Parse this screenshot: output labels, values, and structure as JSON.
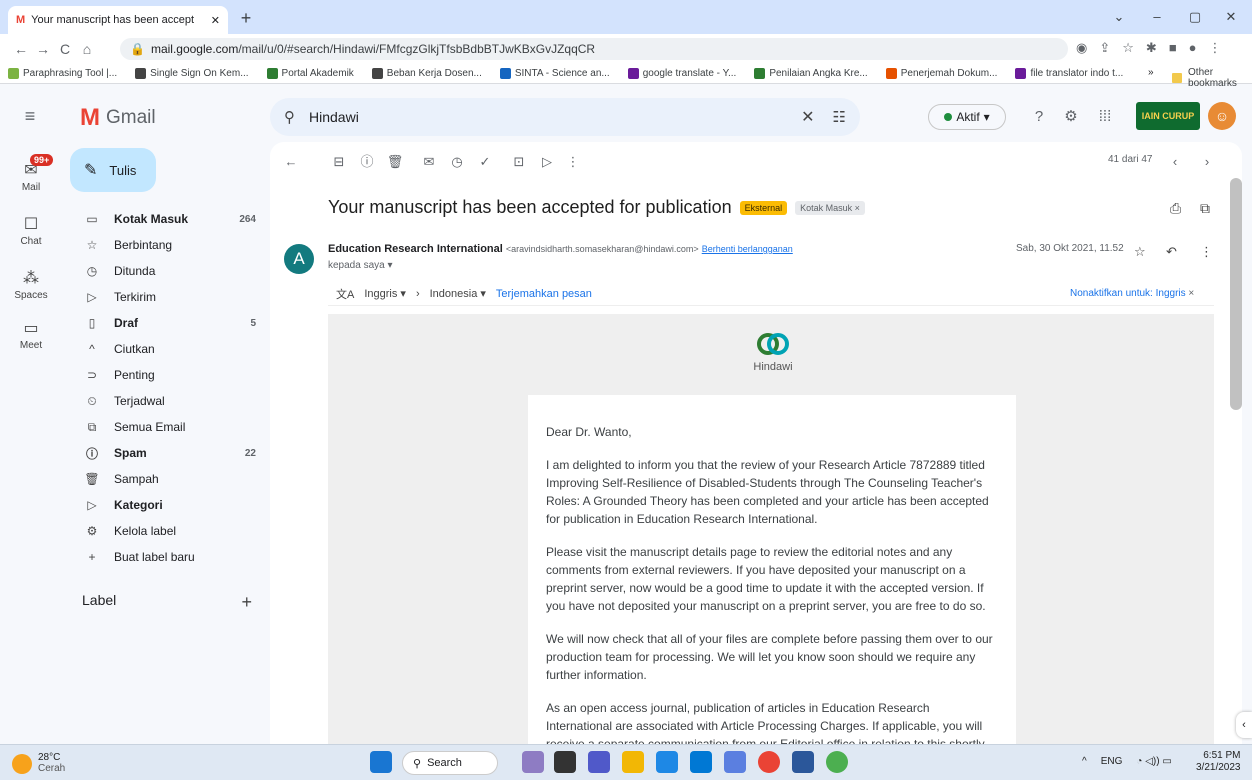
{
  "browser": {
    "tab_title": "Your manuscript has been accept",
    "url_host": "mail.google.com",
    "url_path": "/mail/u/0/#search/Hindawi/FMfcgzGlkjTfsbBdbBTJwKBxGvJZqqCR",
    "bookmarks": [
      {
        "label": "Paraphrasing Tool |...",
        "color": "#7cb342"
      },
      {
        "label": "Single Sign On Kem...",
        "color": "#444"
      },
      {
        "label": "Portal Akademik",
        "color": "#2e7d32"
      },
      {
        "label": "Beban Kerja Dosen...",
        "color": "#444"
      },
      {
        "label": "SINTA - Science an...",
        "color": "#1565c0"
      },
      {
        "label": "google translate - Y...",
        "color": "#6a1b9a"
      },
      {
        "label": "Penilaian Angka Kre...",
        "color": "#2e7d32"
      },
      {
        "label": "Penerjemah Dokum...",
        "color": "#e65100"
      },
      {
        "label": "file translator indo t...",
        "color": "#6a1b9a"
      }
    ],
    "more_bookmarks": "»",
    "other_bookmarks": "Other bookmarks"
  },
  "gmail": {
    "logo_text": "Gmail",
    "search_query": "Hindawi",
    "status_label": "Aktif",
    "org_logo_text": "IAIN CURUP",
    "avatar_initial": "☺"
  },
  "rail": {
    "badge": "99+",
    "items": [
      {
        "label": "Mail",
        "icon": "✉"
      },
      {
        "label": "Chat",
        "icon": "☐"
      },
      {
        "label": "Spaces",
        "icon": "⁂"
      },
      {
        "label": "Meet",
        "icon": "▭"
      }
    ]
  },
  "compose_label": "Tulis",
  "nav": [
    {
      "label": "Kotak Masuk",
      "count": "264",
      "icon": "▭",
      "bold": true,
      "name": "inbox"
    },
    {
      "label": "Berbintang",
      "count": "",
      "icon": "☆",
      "bold": false,
      "name": "starred"
    },
    {
      "label": "Ditunda",
      "count": "",
      "icon": "◷",
      "bold": false,
      "name": "snoozed"
    },
    {
      "label": "Terkirim",
      "count": "",
      "icon": "▷",
      "bold": false,
      "name": "sent"
    },
    {
      "label": "Draf",
      "count": "5",
      "icon": "▯",
      "bold": true,
      "name": "drafts"
    },
    {
      "label": "Ciutkan",
      "count": "",
      "icon": "^",
      "bold": false,
      "name": "collapse"
    },
    {
      "label": "Penting",
      "count": "",
      "icon": "⊃",
      "bold": false,
      "name": "important"
    },
    {
      "label": "Terjadwal",
      "count": "",
      "icon": "⏲",
      "bold": false,
      "name": "scheduled"
    },
    {
      "label": "Semua Email",
      "count": "",
      "icon": "⧉",
      "bold": false,
      "name": "all-mail"
    },
    {
      "label": "Spam",
      "count": "22",
      "icon": "ⓘ",
      "bold": true,
      "name": "spam"
    },
    {
      "label": "Sampah",
      "count": "",
      "icon": "🗑",
      "bold": false,
      "name": "trash"
    },
    {
      "label": "Kategori",
      "count": "",
      "icon": "▷",
      "bold": true,
      "name": "categories"
    },
    {
      "label": "Kelola label",
      "count": "",
      "icon": "⚙",
      "bold": false,
      "name": "manage-labels"
    },
    {
      "label": "Buat label baru",
      "count": "",
      "icon": "+",
      "bold": false,
      "name": "new-label"
    }
  ],
  "label_header": "Label",
  "label_add": "+",
  "pager": "41 dari 47",
  "email": {
    "subject": "Your manuscript has been accepted for publication",
    "tag_external": "Eksternal",
    "tag_inbox": "Kotak Masuk ×",
    "sender_initial": "A",
    "sender_name": "Education Research International",
    "sender_email": "<aravindsidharth.somasekharan@hindawi.com>",
    "unsubscribe": "Berhenti berlangganan",
    "to": "kepada saya ▾",
    "date": "Sab, 30 Okt 2021, 11.52",
    "translate_from": "Inggris ▾",
    "translate_to": "Indonesia ▾",
    "translate_link": "Terjemahkan pesan",
    "translate_off": "Nonaktifkan untuk: Inggris",
    "brand": "Hindawi",
    "body": [
      "Dear Dr. Wanto,",
      "I am delighted to inform you that the review of your Research Article 7872889 titled Improving Self-Resilience of Disabled-Students through The Counseling Teacher's Roles: A Grounded Theory has been completed and your article has been accepted for publication in Education Research International.",
      "Please visit the manuscript details page to review the editorial notes and any comments from external reviewers. If you have deposited your manuscript on a preprint server, now would be a good time to update it with the accepted version. If you have not deposited your manuscript on a preprint server, you are free to do so.",
      "We will now check that all of your files are complete before passing them over to our production team for processing. We will let you know soon should we require any further information.",
      "As an open access journal, publication of articles in Education Research International are associated with Article Processing Charges. If applicable, you will receive a separate communication from our Editorial office in relation to this shortly. In regards to payments"
    ]
  },
  "taskbar": {
    "temp": "28°C",
    "weather": "Cerah",
    "search": "Search",
    "lang": "ENG",
    "time": "6:51 PM",
    "date": "3/21/2023"
  }
}
